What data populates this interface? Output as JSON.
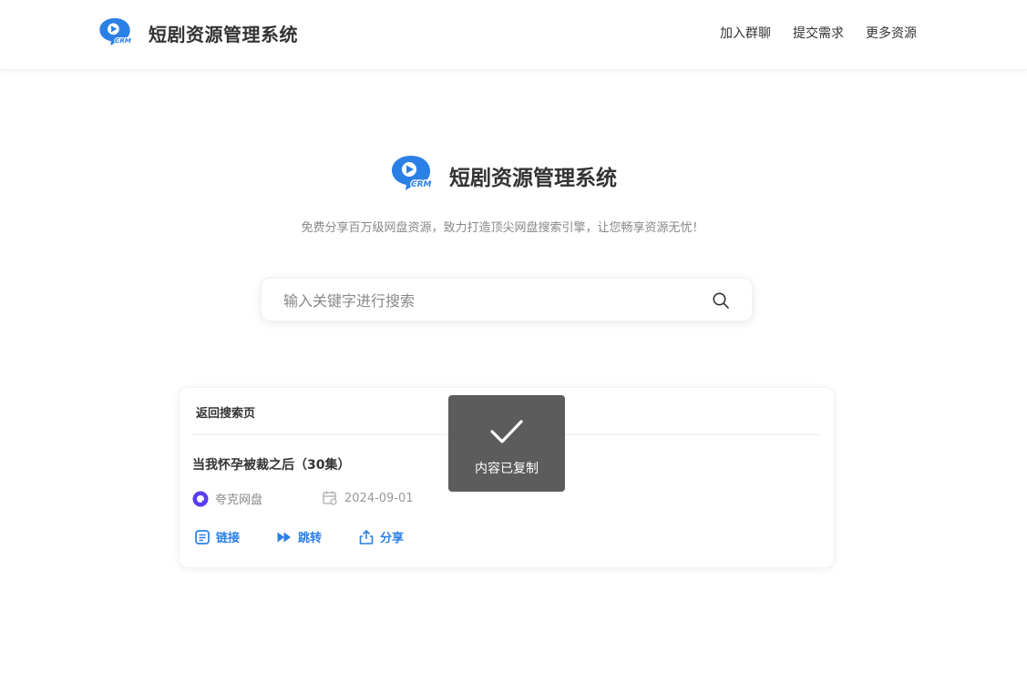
{
  "header": {
    "logo_icon": "crm-logo-icon",
    "logo_text": "CRM",
    "title": "短剧资源管理系统",
    "nav": [
      {
        "label": "加入群聊"
      },
      {
        "label": "提交需求"
      },
      {
        "label": "更多资源"
      }
    ]
  },
  "hero": {
    "logo_icon": "crm-logo-icon",
    "logo_text": "CRM",
    "title": "短剧资源管理系统",
    "subtitle": "免费分享百万级网盘资源，致力打造顶尖网盘搜索引擎，让您畅享资源无忧！"
  },
  "search": {
    "placeholder": "输入关键字进行搜索",
    "value": "",
    "icon": "search-icon"
  },
  "result_card": {
    "back_label": "返回搜索页",
    "item": {
      "title": "当我怀孕被裁之后（30集）",
      "source": "夸克网盘",
      "source_icon": "quark-drive-icon",
      "date": "2024-09-01",
      "date_icon": "calendar-icon"
    },
    "actions": [
      {
        "label": "链接",
        "icon": "link-doc-icon"
      },
      {
        "label": "跳转",
        "icon": "fast-forward-icon"
      },
      {
        "label": "分享",
        "icon": "share-icon"
      }
    ]
  },
  "toast": {
    "icon": "check-icon",
    "message": "内容已复制"
  },
  "colors": {
    "brand": "#2b80e6",
    "text": "#333333",
    "muted": "#888888",
    "quark": "#5b3cf0",
    "toast_bg": "#464646"
  }
}
